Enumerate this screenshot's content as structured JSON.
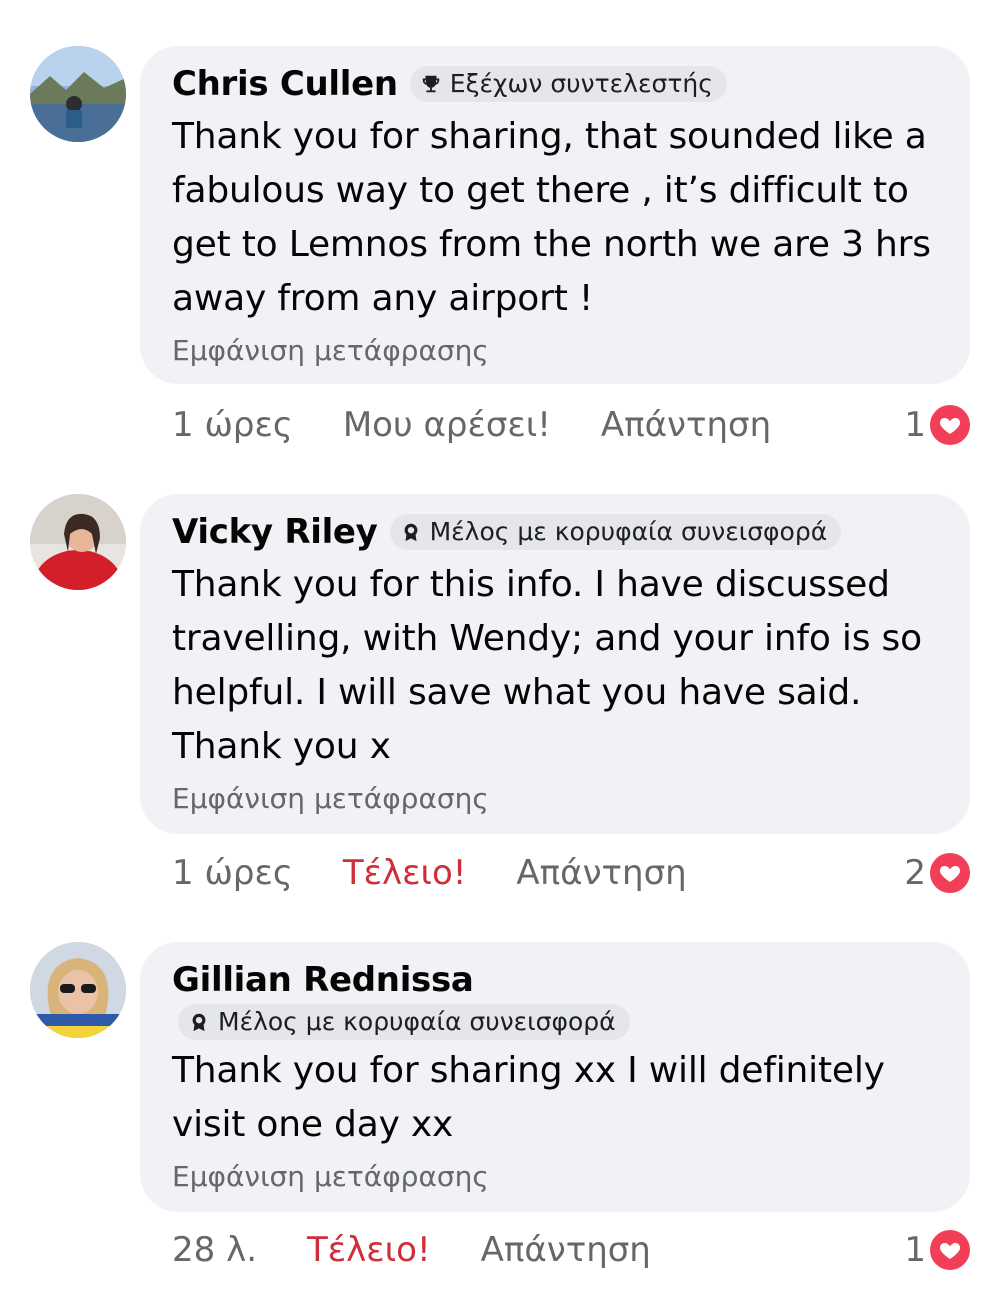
{
  "comments": [
    {
      "author": "Chris Cullen",
      "badge": "Εξέχων συντελεστής",
      "badge_icon": "trophy-icon",
      "text": "Thank you for sharing, that sounded like a fabulous way to get there , it’s difficult to get to Lemnos from the north we are 3 hrs away from any airport !",
      "translate": "Εμφάνιση μετάφρασης",
      "time": "1 ώρες",
      "like_label": "Μου αρέσει!",
      "reply_label": "Απάντηση",
      "reaction_count": "1",
      "reaction_icon": "heart-icon"
    },
    {
      "author": "Vicky Riley",
      "badge": "Μέλος με κορυφαία συνεισφορά",
      "badge_icon": "rosette-icon",
      "text": "Thank you for this info. I have discussed travelling, with Wendy; and your info is so helpful. I will save what you have said. Thank you x",
      "translate": "Εμφάνιση μετάφρασης",
      "time": "1 ώρες",
      "like_label": "Τέλειο!",
      "reply_label": "Απάντηση",
      "reaction_count": "2",
      "reaction_icon": "heart-icon"
    },
    {
      "author": "Gillian Rednissa",
      "badge": "Μέλος με κορυφαία συνεισφορά",
      "badge_icon": "rosette-icon",
      "text": "Thank you for sharing xx I will definitely visit one day xx",
      "translate": "Εμφάνιση μετάφρασης",
      "time": "28 λ.",
      "like_label": "Τέλειο!",
      "reply_label": "Απάντηση",
      "reaction_count": "1",
      "reaction_icon": "heart-icon"
    }
  ],
  "colors": {
    "bubble": "#f0f2f5",
    "meta_text": "#65676b",
    "love_reaction_text": "#cf2d3a",
    "heart": "#f33e58"
  }
}
